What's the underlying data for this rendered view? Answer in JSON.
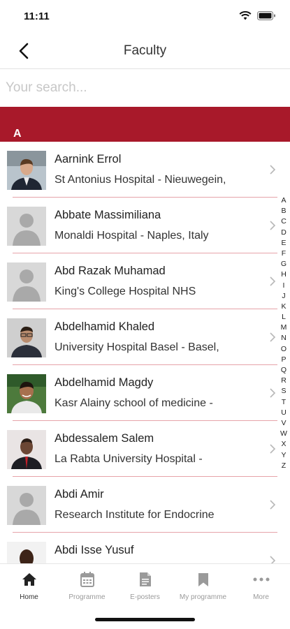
{
  "status": {
    "time": "11:11"
  },
  "nav": {
    "title": "Faculty"
  },
  "search": {
    "placeholder": "Your search..."
  },
  "section": {
    "letter": "A"
  },
  "faculty": [
    {
      "name": "Aarnink Errol",
      "org": "St Antonius Hospital - Nieuwegein,",
      "photo": "photo-man-suit"
    },
    {
      "name": "Abbate Massimiliana",
      "org": "Monaldi Hospital - Naples, Italy",
      "photo": "placeholder-avatar"
    },
    {
      "name": "Abd Razak Muhamad",
      "org": "King's College Hospital NHS",
      "photo": "placeholder-avatar"
    },
    {
      "name": "Abdelhamid Khaled",
      "org": "University Hospital Basel - Basel,",
      "photo": "photo-man-glasses"
    },
    {
      "name": "Abdelhamid Magdy",
      "org": "Kasr Alainy school of medicine -",
      "photo": "photo-man-smiling"
    },
    {
      "name": "Abdessalem Salem",
      "org": "La Rabta University Hospital -",
      "photo": "photo-man-red-tie"
    },
    {
      "name": "Abdi Amir",
      "org": "Research Institute for Endocrine",
      "photo": "placeholder-avatar"
    },
    {
      "name": "Abdi Isse Yusuf",
      "org": "",
      "photo": "photo-man-dark"
    }
  ],
  "alphabet": [
    "A",
    "B",
    "C",
    "D",
    "E",
    "F",
    "G",
    "H",
    "I",
    "J",
    "K",
    "L",
    "M",
    "N",
    "O",
    "P",
    "Q",
    "R",
    "S",
    "T",
    "U",
    "V",
    "W",
    "X",
    "Y",
    "Z"
  ],
  "tabs": [
    {
      "label": "Home",
      "icon": "home-icon"
    },
    {
      "label": "Programme",
      "icon": "calendar-icon"
    },
    {
      "label": "E-posters",
      "icon": "document-icon"
    },
    {
      "label": "My programme",
      "icon": "bookmark-icon"
    },
    {
      "label": "More",
      "icon": "more-icon"
    }
  ],
  "colors": {
    "accent": "#a8192a",
    "separator": "#e6a3a9",
    "tab_inactive": "#9a9a9a"
  }
}
